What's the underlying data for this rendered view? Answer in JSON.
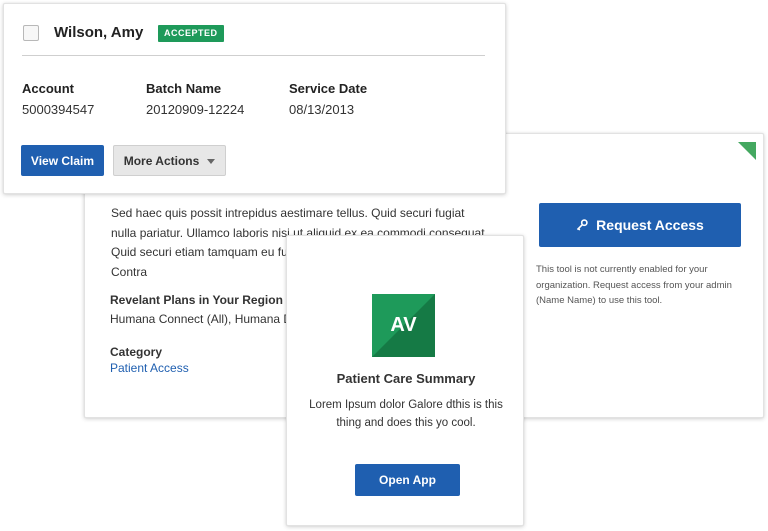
{
  "claim_card": {
    "patient_name": "Wilson, Amy",
    "status_badge": "ACCEPTED",
    "fields": [
      {
        "label": "Account",
        "value": "5000394547"
      },
      {
        "label": "Batch Name",
        "value": "20120909-12224"
      },
      {
        "label": "Service Date",
        "value": "08/13/2013"
      }
    ],
    "view_claim_label": "View Claim",
    "more_actions_label": "More Actions"
  },
  "tool_card": {
    "description": "Sed haec quis possit intrepidus aestimare tellus. Quid securi fugiat nulla pariatur. Ullamco laboris nisi ut aliquid ex ea commodi consequat. Quid securi etiam tamquam eu fugiat nu tractata ab fiducia dicuntur. Contra",
    "plans_title": "Revelant Plans in Your Region",
    "plans_value": "Humana Connect (All), Humana Di",
    "category_title": "Category",
    "category_value": "Patient Access",
    "request_access_label": "Request Access",
    "request_note": "This tool is not currently enabled for your organization. Request access from your admin (Name Name) to use this tool."
  },
  "app_card": {
    "logo_text": "AV",
    "title": "Patient Care Summary",
    "description": "Lorem Ipsum dolor Galore dthis is this thing and does this yo cool.",
    "open_label": "Open App"
  },
  "colors": {
    "primary_blue": "#1f5fb0",
    "accent_green": "#1e9a5a"
  },
  "icons": {
    "request_access": "key-icon",
    "more_actions": "chevron-down-icon",
    "card_corner": "corner-flag-icon"
  }
}
